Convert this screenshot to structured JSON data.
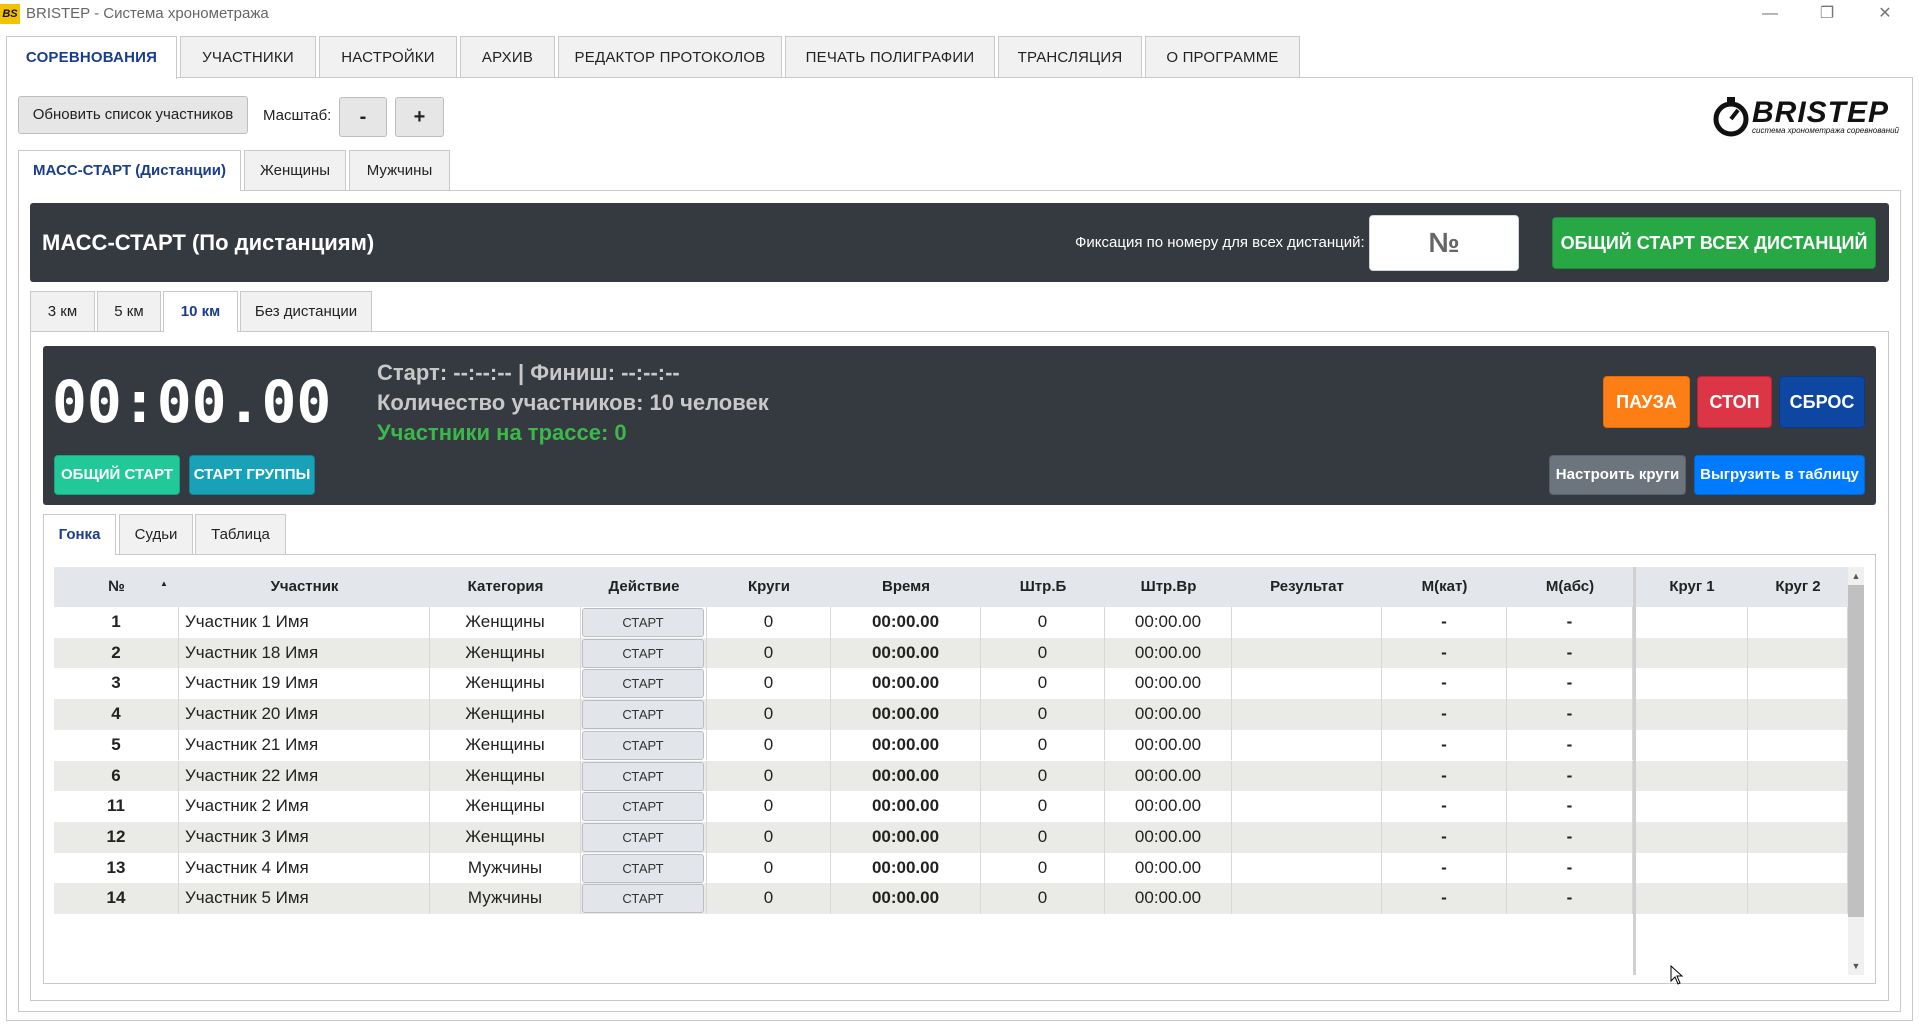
{
  "window": {
    "app_icon_text": "BS",
    "title": "BRISTEP - Система хронометража",
    "min_glyph": "—",
    "max_glyph": "❐",
    "close_glyph": "✕"
  },
  "main_tabs": [
    {
      "label": "СОРЕВНОВАНИЯ",
      "active": true
    },
    {
      "label": "УЧАСТНИКИ"
    },
    {
      "label": "НАСТРОЙКИ"
    },
    {
      "label": "АРХИВ"
    },
    {
      "label": "РЕДАКТОР ПРОТОКОЛОВ"
    },
    {
      "label": "ПЕЧАТЬ ПОЛИГРАФИИ"
    },
    {
      "label": "ТРАНСЛЯЦИЯ"
    },
    {
      "label": "О ПРОГРАММЕ"
    }
  ],
  "toolbar": {
    "refresh_label": "Обновить список участников",
    "scale_label": "Масштаб:",
    "minus_label": "-",
    "plus_label": "+"
  },
  "logo": {
    "text": "BRISTEP",
    "subtitle": "система хронометража соревнований"
  },
  "sub_tabs": [
    {
      "label": "МАСС-СТАРТ (Дистанции)",
      "active": true
    },
    {
      "label": "Женщины"
    },
    {
      "label": "Мужчины"
    }
  ],
  "mass_start": {
    "title": "МАСС-СТАРТ (По дистанциям)",
    "fix_label": "Фиксация по номеру для всех дистанций:",
    "fix_placeholder": "№",
    "start_all_label": "ОБЩИЙ СТАРТ ВСЕХ ДИСТАНЦИЙ"
  },
  "distance_tabs": [
    {
      "label": "3 км"
    },
    {
      "label": "5 км"
    },
    {
      "label": "10 км",
      "active": true
    },
    {
      "label": "Без дистанции"
    }
  ],
  "timer_panel": {
    "time": "00:00.00",
    "start_finish": "Старт: --:--:-- | Финиш: --:--:--",
    "participants_count": "Количество участников: 10 человек",
    "on_track": "Участники на трассе: 0",
    "general_start": "ОБЩИЙ СТАРТ",
    "group_start": "СТАРТ ГРУППЫ",
    "pause": "ПАУЗА",
    "stop": "СТОП",
    "reset": "СБРОС",
    "configure_laps": "Настроить круги",
    "export": "Выгрузить в таблицу"
  },
  "inner_tabs": [
    {
      "label": "Гонка",
      "active": true
    },
    {
      "label": "Судьи"
    },
    {
      "label": "Таблица"
    }
  ],
  "table": {
    "headers": [
      "№",
      "Участник",
      "Категория",
      "Действие",
      "Круги",
      "Время",
      "Штр.Б",
      "Штр.Вр",
      "Результат",
      "М(кат)",
      "М(абс)",
      "Круг 1",
      "Круг 2"
    ],
    "sort_indicator": "▲",
    "rows": [
      {
        "num": "1",
        "name": "Участник 1 Имя",
        "category": "Женщины",
        "action": "СТАРТ",
        "laps": "0",
        "time": "00:00.00",
        "pen_b": "0",
        "pen_t": "00:00.00",
        "result": "",
        "place_cat": "-",
        "place_abs": "-"
      },
      {
        "num": "2",
        "name": "Участник 18 Имя",
        "category": "Женщины",
        "action": "СТАРТ",
        "laps": "0",
        "time": "00:00.00",
        "pen_b": "0",
        "pen_t": "00:00.00",
        "result": "",
        "place_cat": "-",
        "place_abs": "-"
      },
      {
        "num": "3",
        "name": "Участник 19 Имя",
        "category": "Женщины",
        "action": "СТАРТ",
        "laps": "0",
        "time": "00:00.00",
        "pen_b": "0",
        "pen_t": "00:00.00",
        "result": "",
        "place_cat": "-",
        "place_abs": "-"
      },
      {
        "num": "4",
        "name": "Участник 20 Имя",
        "category": "Женщины",
        "action": "СТАРТ",
        "laps": "0",
        "time": "00:00.00",
        "pen_b": "0",
        "pen_t": "00:00.00",
        "result": "",
        "place_cat": "-",
        "place_abs": "-"
      },
      {
        "num": "5",
        "name": "Участник 21 Имя",
        "category": "Женщины",
        "action": "СТАРТ",
        "laps": "0",
        "time": "00:00.00",
        "pen_b": "0",
        "pen_t": "00:00.00",
        "result": "",
        "place_cat": "-",
        "place_abs": "-"
      },
      {
        "num": "6",
        "name": "Участник 22 Имя",
        "category": "Женщины",
        "action": "СТАРТ",
        "laps": "0",
        "time": "00:00.00",
        "pen_b": "0",
        "pen_t": "00:00.00",
        "result": "",
        "place_cat": "-",
        "place_abs": "-"
      },
      {
        "num": "11",
        "name": "Участник 2 Имя",
        "category": "Женщины",
        "action": "СТАРТ",
        "laps": "0",
        "time": "00:00.00",
        "pen_b": "0",
        "pen_t": "00:00.00",
        "result": "",
        "place_cat": "-",
        "place_abs": "-"
      },
      {
        "num": "12",
        "name": "Участник 3 Имя",
        "category": "Женщины",
        "action": "СТАРТ",
        "laps": "0",
        "time": "00:00.00",
        "pen_b": "0",
        "pen_t": "00:00.00",
        "result": "",
        "place_cat": "-",
        "place_abs": "-"
      },
      {
        "num": "13",
        "name": "Участник 4 Имя",
        "category": "Мужчины",
        "action": "СТАРТ",
        "laps": "0",
        "time": "00:00.00",
        "pen_b": "0",
        "pen_t": "00:00.00",
        "result": "",
        "place_cat": "-",
        "place_abs": "-"
      },
      {
        "num": "14",
        "name": "Участник 5 Имя",
        "category": "Мужчины",
        "action": "СТАРТ",
        "laps": "0",
        "time": "00:00.00",
        "pen_b": "0",
        "pen_t": "00:00.00",
        "result": "",
        "place_cat": "-",
        "place_abs": "-"
      }
    ]
  },
  "colors": {
    "dark_panel": "#343a40",
    "green": "#28a745",
    "teal": "#20c997",
    "cyan": "#17a2b8",
    "orange": "#fd7e14",
    "red": "#dc3545",
    "navy": "#0d47a1",
    "blue": "#007bff",
    "gray": "#6c757d"
  }
}
